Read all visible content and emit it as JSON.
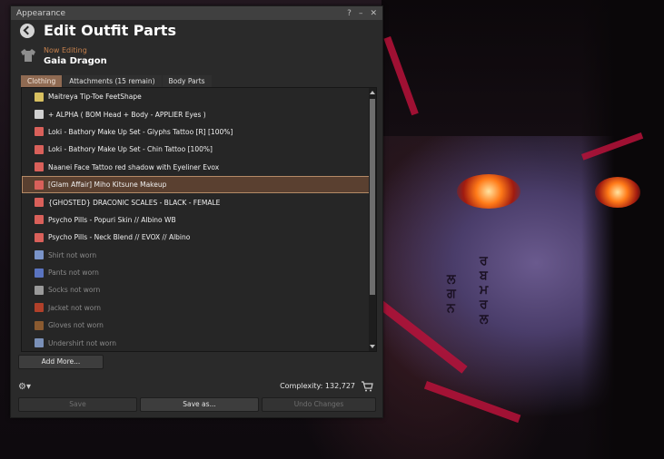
{
  "window": {
    "title": "Appearance",
    "controls": [
      "?",
      "–",
      "✕"
    ]
  },
  "panel": {
    "title": "Edit Outfit Parts",
    "now_editing_label": "Now Editing",
    "outfit_name": "Gaia Dragon"
  },
  "tabs": [
    {
      "label": "Clothing",
      "active": true
    },
    {
      "label": "Attachments (15 remain)",
      "active": false
    },
    {
      "label": "Body Parts",
      "active": false
    }
  ],
  "items": [
    {
      "label": "Maitreya Tip-Toe FeetShape",
      "icon": "shape-icon",
      "worn": true
    },
    {
      "label": "+ ALPHA ( BOM Head + Body - APPLIER Eyes )",
      "icon": "alpha-icon",
      "worn": true
    },
    {
      "label": "Loki - Bathory Make Up Set - Glyphs Tattoo [R] [100%]",
      "icon": "tattoo-icon",
      "worn": true
    },
    {
      "label": "Loki - Bathory Make Up Set - Chin Tattoo [100%]",
      "icon": "tattoo-icon",
      "worn": true
    },
    {
      "label": "Naanei Face Tattoo red shadow with Eyeliner Evox",
      "icon": "tattoo-icon",
      "worn": true
    },
    {
      "label": "[Glam Affair] Miho Kitsune Makeup",
      "icon": "tattoo-icon",
      "worn": true,
      "selected": true
    },
    {
      "label": "{GHOSTED} DRACONIC SCALES - BLACK - FEMALE",
      "icon": "tattoo-icon",
      "worn": true
    },
    {
      "label": "Psycho Pills - Popuri Skin // Albino WB",
      "icon": "tattoo-icon",
      "worn": true
    },
    {
      "label": "Psycho Pills - Neck Blend // EVOX // Albino",
      "icon": "tattoo-icon",
      "worn": true
    },
    {
      "label": "Shirt not worn",
      "icon": "shirt-icon",
      "worn": false
    },
    {
      "label": "Pants not worn",
      "icon": "pants-icon",
      "worn": false
    },
    {
      "label": "Socks not worn",
      "icon": "socks-icon",
      "worn": false
    },
    {
      "label": "Jacket not worn",
      "icon": "jacket-icon",
      "worn": false
    },
    {
      "label": "Gloves not worn",
      "icon": "gloves-icon",
      "worn": false
    },
    {
      "label": "Undershirt not worn",
      "icon": "undershirt-icon",
      "worn": false
    }
  ],
  "buttons": {
    "add_more": "Add More...",
    "save": "Save",
    "save_as": "Save as...",
    "undo": "Undo Changes"
  },
  "footer": {
    "complexity": "Complexity: 132,727"
  },
  "colors": {
    "accent": "#8f6a52",
    "now_editing": "#c6814d",
    "tattoo_icon": "#d9605a"
  }
}
